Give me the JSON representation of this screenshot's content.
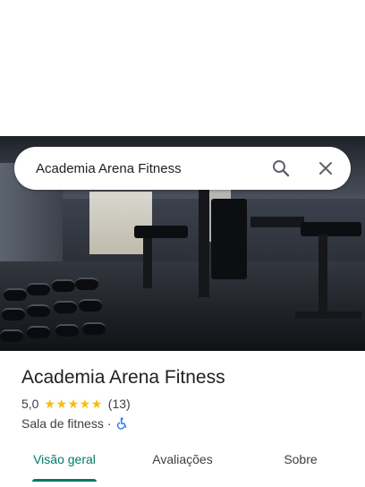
{
  "search": {
    "query": "Academia Arena Fitness"
  },
  "icons": {
    "search": "search-icon",
    "close": "close-icon",
    "accessibility": "wheelchair-icon"
  },
  "place": {
    "name": "Academia Arena Fitness",
    "rating": "5,0",
    "stars": [
      "★",
      "★",
      "★",
      "★",
      "★"
    ],
    "review_count": "(13)",
    "category": "Sala de fitness",
    "separator": "·"
  },
  "tabs": [
    {
      "label": "Visão geral",
      "active": true
    },
    {
      "label": "Avaliações",
      "active": false
    },
    {
      "label": "Sobre",
      "active": false
    }
  ],
  "colors": {
    "accent": "#00796b",
    "star": "#fbbc04",
    "access_icon": "#1a73e8"
  }
}
